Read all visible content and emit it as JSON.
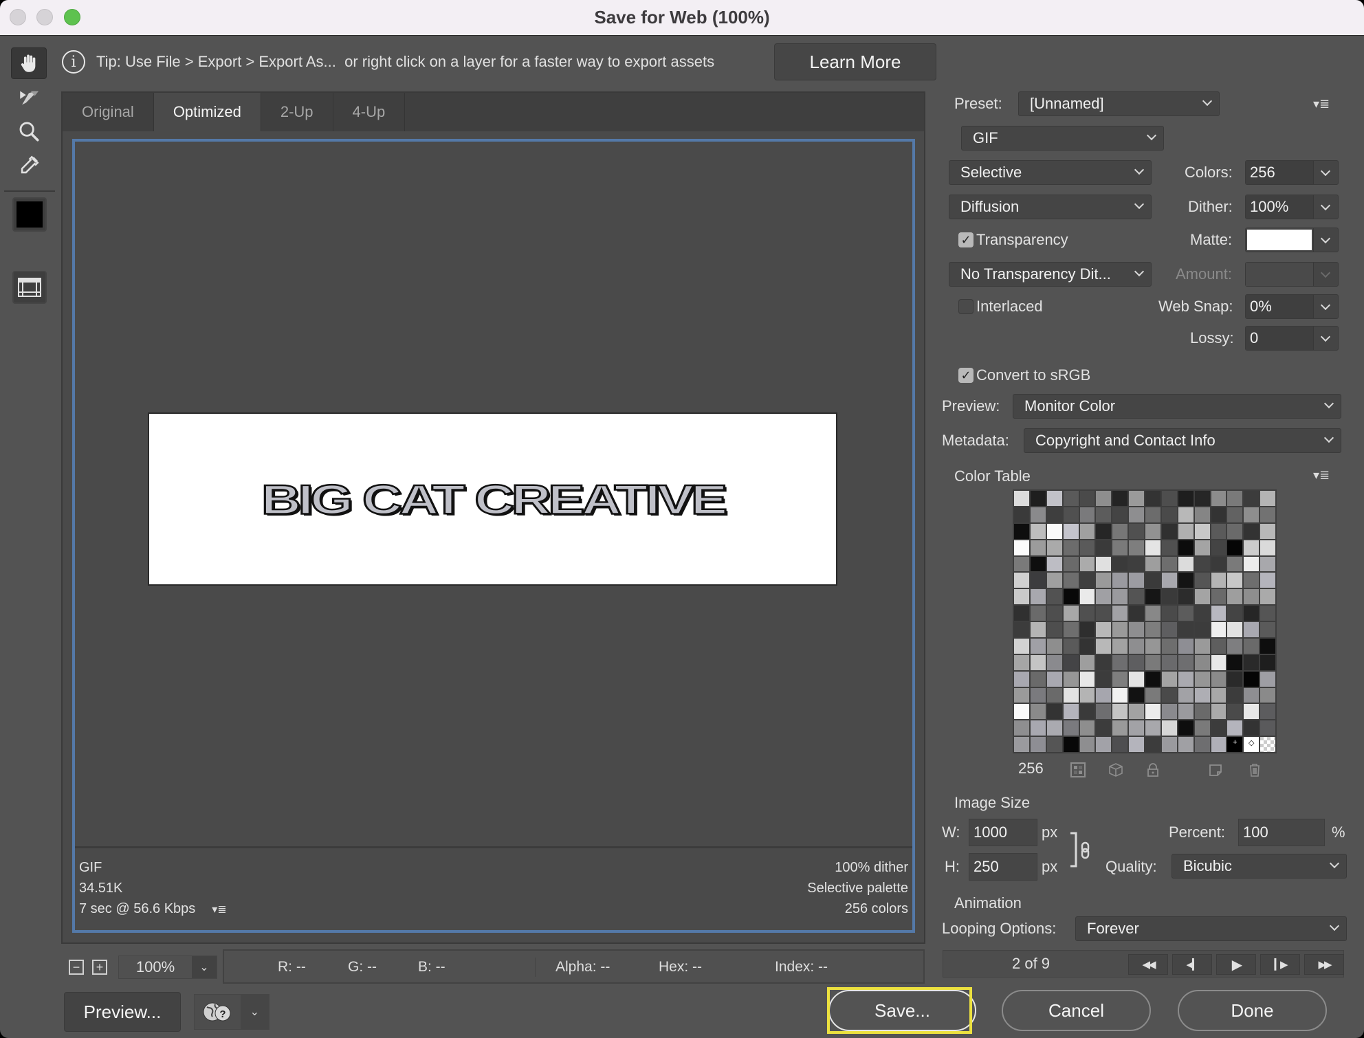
{
  "window": {
    "title": "Save for Web (100%)"
  },
  "tools": [
    {
      "name": "hand-tool",
      "icon": "hand-icon",
      "active": true
    },
    {
      "name": "slice-select-tool",
      "icon": "slice-select-icon",
      "active": false
    },
    {
      "name": "zoom-tool",
      "icon": "magnifier-icon",
      "active": false
    },
    {
      "name": "eyedropper-tool",
      "icon": "eyedropper-icon",
      "active": false
    }
  ],
  "eyedropper_color": "#000000",
  "tip": {
    "text": "Tip: Use File > Export > Export As...  or right click on a layer for a faster way to export assets",
    "learn_more": "Learn More"
  },
  "tabs": [
    {
      "label": "Original",
      "active": false
    },
    {
      "label": "Optimized",
      "active": true
    },
    {
      "label": "2-Up",
      "active": false
    },
    {
      "label": "4-Up",
      "active": false
    }
  ],
  "preview_image": {
    "text": "BIG CAT CREATIVE"
  },
  "optimized_info": {
    "format": "GIF",
    "size": "34.51K",
    "download_time": "7 sec @ 56.6 Kbps",
    "dither": "100% dither",
    "palette": "Selective palette",
    "colors": "256 colors"
  },
  "zoom": {
    "value": "100%"
  },
  "readout": {
    "r": "R: --",
    "g": "G: --",
    "b": "B: --",
    "alpha": "Alpha: --",
    "hex": "Hex: --",
    "index": "Index: --"
  },
  "buttons": {
    "preview": "Preview...",
    "save": "Save...",
    "cancel": "Cancel",
    "done": "Done"
  },
  "settings": {
    "preset_label": "Preset:",
    "preset_value": "[Unnamed]",
    "format": "GIF",
    "reduction": "Selective",
    "dither_algorithm": "Diffusion",
    "colors_label": "Colors:",
    "colors_value": "256",
    "dither_label": "Dither:",
    "dither_value": "100%",
    "transparency_label": "Transparency",
    "transparency_checked": true,
    "matte_label": "Matte:",
    "matte_color": "#ffffff",
    "transparency_dither": "No Transparency Dit...",
    "amount_label": "Amount:",
    "amount_value": "",
    "interlaced_label": "Interlaced",
    "interlaced_checked": false,
    "web_snap_label": "Web Snap:",
    "web_snap_value": "0%",
    "lossy_label": "Lossy:",
    "lossy_value": "0",
    "convert_srgb_label": "Convert to sRGB",
    "convert_srgb_checked": true,
    "preview_label": "Preview:",
    "preview_value": "Monitor Color",
    "metadata_label": "Metadata:",
    "metadata_value": "Copyright and Contact Info"
  },
  "color_table": {
    "title": "Color Table",
    "count": "256",
    "swatches": [
      "#dcdcdc",
      "#1e1e1e",
      "#c2c2c8",
      "#5a5a5a",
      "#4a4a4a",
      "#8e8e8e",
      "#242424",
      "#9a9a9a",
      "#333333",
      "#4e4e4e",
      "#1e1e1e",
      "#262626",
      "#8c8c8c",
      "#7a7a7a",
      "#3c3c3c",
      "#b4b4b4",
      "#3a3a3a",
      "#8a8a8c",
      "#3e3e3e",
      "#505050",
      "#7a7a7c",
      "#5c5c5c",
      "#444444",
      "#8e8e90",
      "#6c6c6c",
      "#4a4a4a",
      "#b8b8b8",
      "#858585",
      "#333333",
      "#626262",
      "#8e8e8e",
      "#727272",
      "#0e0e0e",
      "#bdbdbd",
      "#fafafa",
      "#c4c4cc",
      "#a0a0a0",
      "#262626",
      "#777777",
      "#505050",
      "#929292",
      "#303030",
      "#b0b0b0",
      "#c8c8c8",
      "#5a5a5a",
      "#6a6a6a",
      "#333333",
      "#b8b8b8",
      "#fbfbfb",
      "#9c9c9c",
      "#aaaaaa",
      "#6c6c6c",
      "#5a5a5a",
      "#3a3a3a",
      "#7a7a7a",
      "#7e7e7e",
      "#e4e4e4",
      "#505050",
      "#0c0c0c",
      "#a4a4a4",
      "#444444",
      "#050505",
      "#cccccc",
      "#dadada",
      "#7a7a7a",
      "#0e0e0e",
      "#bdbdc4",
      "#6a6a6a",
      "#ababab",
      "#e0e0e0",
      "#3a3a3a",
      "#3e3e3e",
      "#9e9e9e",
      "#6e6e6e",
      "#dcdcdc",
      "#444444",
      "#3a3a3a",
      "#7a7a7a",
      "#ececec",
      "#a8a8ac",
      "#d0d0d0",
      "#3c3c3e",
      "#a0a0a0",
      "#6e6e6e",
      "#3e3e3e",
      "#9a9a9a",
      "#9a9aa0",
      "#9c9ca2",
      "#3a3a3a",
      "#a8a8ae",
      "#141414",
      "#555555",
      "#b4b4b4",
      "#c8c8c8",
      "#6e6e6e",
      "#b4b4bc",
      "#cacaca",
      "#a8a8ae",
      "#525252",
      "#080808",
      "#eaeaea",
      "#a0a0a4",
      "#9a9a9e",
      "#545454",
      "#161616",
      "#3a3a3a",
      "#2c2c2c",
      "#a4a4a4",
      "#6a6a6a",
      "#9e9e9e",
      "#8e8e8e",
      "#aaaaaa",
      "#303030",
      "#6a6a6a",
      "#4e4e4e",
      "#a8a8a8",
      "#505050",
      "#4e4e4e",
      "#a2a2a6",
      "#333333",
      "#888888",
      "#4a4a4a",
      "#5c5c5c",
      "#3e3e3e",
      "#b8b8c0",
      "#444444",
      "#262626",
      "#555555",
      "#3c3c3c",
      "#b4b4b4",
      "#4e4e4e",
      "#6e6e6e",
      "#2e2e2e",
      "#b8b8b8",
      "#9a9a9a",
      "#8e8e90",
      "#7e7e7e",
      "#5e5e60",
      "#3c3c3c",
      "#3c3c3c",
      "#eeeeee",
      "#e2e2e2",
      "#a8a8b0",
      "#5a5a5a",
      "#d2d2d2",
      "#a0a0a6",
      "#8e8e8e",
      "#5a5a5a",
      "#333333",
      "#b8b8b8",
      "#a2a2a2",
      "#8e8e90",
      "#969696",
      "#6e6e6e",
      "#8e8e94",
      "#9a9a9a",
      "#5e5e5e",
      "#7e7e80",
      "#6a6a6a",
      "#0e0e0e",
      "#a6a6a6",
      "#c4c4c4",
      "#8a8a8e",
      "#444446",
      "#9e9e9e",
      "#3a3a3a",
      "#6e6e70",
      "#5e5e60",
      "#7a7a7a",
      "#6a6a6c",
      "#6e6e70",
      "#8a8a8a",
      "#e8e8e8",
      "#0e0e0e",
      "#2a2a2a",
      "#1e1e1e",
      "#a8a8b0",
      "#6a6a6a",
      "#a8a8b0",
      "#969696",
      "#e8e8e8",
      "#3c3c3c",
      "#7e7e7e",
      "#e4e4e4",
      "#0e0e0e",
      "#a4a4a4",
      "#aaaab0",
      "#969696",
      "#8a8a8a",
      "#2a2a2a",
      "#050505",
      "#9e9ea4",
      "#9a9a9a",
      "#7a7a7e",
      "#6a6a6a",
      "#e2e2e2",
      "#b4b4b4",
      "#a6a6ae",
      "#f2f2f2",
      "#121212",
      "#7a7a7a",
      "#4a4a4a",
      "#a2a2a6",
      "#aeaeb4",
      "#a8a8a8",
      "#3c3c3c",
      "#8e8e92",
      "#8a8a8a",
      "#fafafa",
      "#8a8a8a",
      "#333333",
      "#b4b4bc",
      "#3a3a3a",
      "#6e6e70",
      "#c4c4c4",
      "#a2a2a2",
      "#ececec",
      "#8a8a8e",
      "#9a9a9e",
      "#6a6a6a",
      "#aaaaaa",
      "#4a4a4a",
      "#e8e8e8",
      "#5c5c5e",
      "#8e8e90",
      "#a8a8b0",
      "#aaaab0",
      "#7a7a7e",
      "#8e8e8e",
      "#3c3c3c",
      "#9a9a9a",
      "#a2a2a6",
      "#a8a8ac",
      "#d6d6d6",
      "#0e0e0e",
      "#7a7a7a",
      "#3c3c3c",
      "#b4b4bc",
      "#333333",
      "#5a5a5c",
      "#9a9a9e",
      "#8e8e94",
      "#555555",
      "#080808",
      "#8e8e90",
      "#a2a2a8",
      "#4e4e50",
      "#b4b4bc",
      "#3c3c3c",
      "#9a9a9e",
      "#a0a0a4",
      "#6e6e70",
      "#b0b0b8",
      "#000000",
      "#ffffff",
      "#transparent"
    ],
    "footer_icons": [
      "web-shift-icon",
      "web-safe-cube-icon",
      "lock-icon",
      "new-color-icon",
      "trash-icon"
    ]
  },
  "image_size": {
    "title": "Image Size",
    "w_label": "W:",
    "w_value": "1000",
    "w_unit": "px",
    "h_label": "H:",
    "h_value": "250",
    "h_unit": "px",
    "percent_label": "Percent:",
    "percent_value": "100",
    "percent_unit": "%",
    "quality_label": "Quality:",
    "quality_value": "Bicubic"
  },
  "animation": {
    "title": "Animation",
    "looping_label": "Looping Options:",
    "looping_value": "Forever",
    "frame_counter": "2 of 9"
  }
}
